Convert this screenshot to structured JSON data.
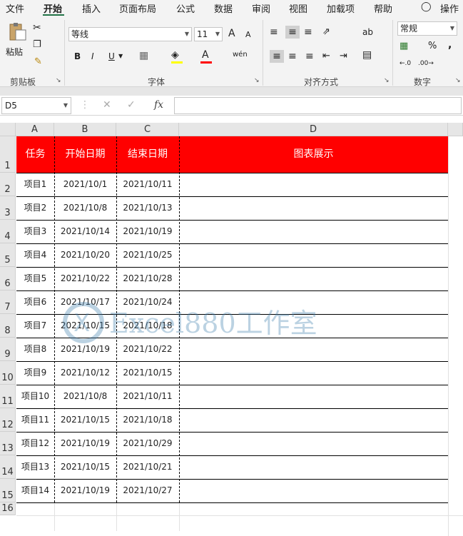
{
  "menu": {
    "items": [
      "文件",
      "开始",
      "插入",
      "页面布局",
      "公式",
      "数据",
      "审阅",
      "视图",
      "加载项",
      "帮助"
    ],
    "active": "开始",
    "tell_me": "操作"
  },
  "ribbon": {
    "clipboard": {
      "paste": "粘贴",
      "group": "剪贴板"
    },
    "font": {
      "name": "等线",
      "size": "11",
      "bold": "B",
      "italic": "I",
      "underline": "U",
      "grow": "A",
      "shrink": "A",
      "color_letter": "A",
      "phonetic": "wén",
      "group": "字体"
    },
    "alignment": {
      "group": "对齐方式",
      "wrap": "ab"
    },
    "number": {
      "format": "常规",
      "percent": "%",
      "comma": ",",
      "group": "数字"
    }
  },
  "formula_bar": {
    "name_box": "D5",
    "fx": "fx",
    "cancel": "✕",
    "enter": "✓",
    "value": ""
  },
  "columns": [
    "A",
    "B",
    "C",
    "D"
  ],
  "rows": [
    "1",
    "2",
    "3",
    "4",
    "5",
    "6",
    "7",
    "8",
    "9",
    "10",
    "11",
    "12",
    "13",
    "14",
    "15",
    "16"
  ],
  "header": [
    "任务",
    "开始日期",
    "结束日期",
    "图表展示"
  ],
  "data": [
    [
      "项目1",
      "2021/10/1",
      "2021/10/11"
    ],
    [
      "项目2",
      "2021/10/8",
      "2021/10/13"
    ],
    [
      "项目3",
      "2021/10/14",
      "2021/10/19"
    ],
    [
      "项目4",
      "2021/10/20",
      "2021/10/25"
    ],
    [
      "项目5",
      "2021/10/22",
      "2021/10/28"
    ],
    [
      "项目6",
      "2021/10/17",
      "2021/10/24"
    ],
    [
      "项目7",
      "2021/10/15",
      "2021/10/18"
    ],
    [
      "项目8",
      "2021/10/19",
      "2021/10/22"
    ],
    [
      "项目9",
      "2021/10/12",
      "2021/10/15"
    ],
    [
      "项目10",
      "2021/10/8",
      "2021/10/11"
    ],
    [
      "项目11",
      "2021/10/15",
      "2021/10/18"
    ],
    [
      "项目12",
      "2021/10/19",
      "2021/10/29"
    ],
    [
      "项目13",
      "2021/10/15",
      "2021/10/21"
    ],
    [
      "项目14",
      "2021/10/19",
      "2021/10/27"
    ]
  ],
  "watermark": "Excel880工作室",
  "colors": {
    "header_fill": "#ff0000",
    "header_text": "#ffffff",
    "accent": "#217346"
  }
}
